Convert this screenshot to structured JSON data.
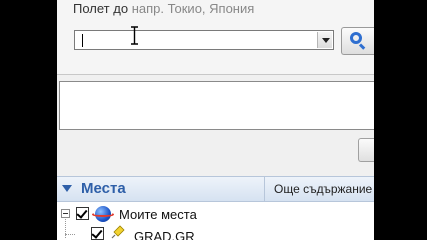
{
  "fly_to": {
    "label": "Полет до",
    "hint": "напр. Токио, Япония",
    "input_value": ""
  },
  "places": {
    "title": "Места",
    "more_content": "Още съдържание"
  },
  "tree": {
    "items": [
      {
        "label": "Моите места",
        "checked": true
      },
      {
        "label": "GRAD.GR",
        "checked": true
      }
    ]
  },
  "colors": {
    "accent": "#2e5fa8",
    "search_icon": "#2f6fd0"
  },
  "icons": {
    "search": "magnifier-icon",
    "dropdown": "chevron-down-icon",
    "places_toggle": "triangle-down-icon",
    "my_places": "earth-globe-icon",
    "placemark": "yellow-pushpin-icon"
  }
}
